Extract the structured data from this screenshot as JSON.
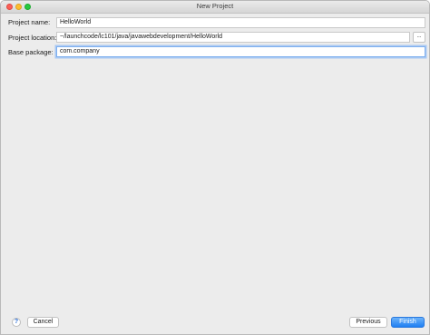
{
  "window": {
    "title": "New Project"
  },
  "form": {
    "project_name_label": "Project name:",
    "project_name_value": "HelloWorld",
    "project_location_label": "Project location:",
    "project_location_value": "~/launchcode/lc101/java/javawebdevelopment/HelloWorld",
    "browse_label": "...",
    "base_package_label": "Base package:",
    "base_package_value": "com.company"
  },
  "footer": {
    "help_label": "?",
    "cancel_label": "Cancel",
    "previous_label": "Previous",
    "finish_label": "Finish"
  },
  "colors": {
    "accent": "#1f7ff2",
    "window_bg": "#ececec",
    "focus_ring": "#a9c9f3"
  }
}
